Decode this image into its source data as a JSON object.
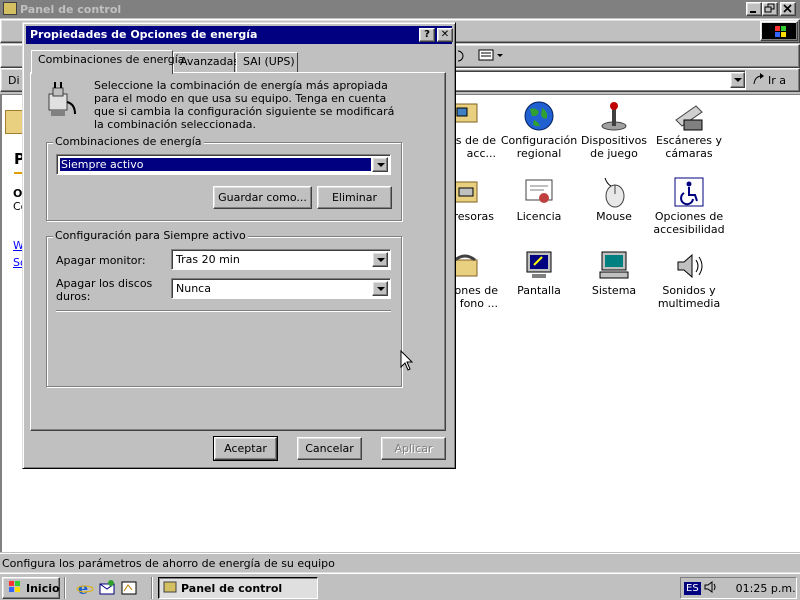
{
  "background_window": {
    "title": "Panel de control",
    "title_icon": "control-panel-icon",
    "controls": [
      "minimize-icon",
      "restore-icon",
      "close-icon"
    ],
    "go_label": "Ir a",
    "left_fragments": [
      "Di",
      "P",
      "O",
      "Co",
      "W",
      "So"
    ],
    "items": [
      {
        "label": "xiones de de acc...",
        "icon": "network-dialup-icon"
      },
      {
        "label": "Configuración regional",
        "icon": "globe-icon"
      },
      {
        "label": "Dispositivos de juego",
        "icon": "joystick-icon"
      },
      {
        "label": "Escáneres y cámaras",
        "icon": "scanner-icon"
      },
      {
        "label": "resoras",
        "icon": "printer-folder-icon"
      },
      {
        "label": "Licencia",
        "icon": "certificate-icon"
      },
      {
        "label": "Mouse",
        "icon": "mouse-icon"
      },
      {
        "label": "Opciones de accesibilidad",
        "icon": "accessibility-icon"
      },
      {
        "label": "iones de fono ...",
        "icon": "telephone-icon"
      },
      {
        "label": "Pantalla",
        "icon": "display-icon"
      },
      {
        "label": "Sistema",
        "icon": "computer-icon"
      },
      {
        "label": "Sonidos y multimedia",
        "icon": "speaker-icon"
      }
    ],
    "status_text": "Configura los parámetros de ahorro de energía de su equipo"
  },
  "dialog": {
    "title": "Propiedades de Opciones de energía",
    "help_button": "?",
    "close_button": "✕",
    "tabs": [
      {
        "label": "Combinaciones de energía",
        "active": true
      },
      {
        "label": "Avanzadas",
        "active": false
      },
      {
        "label": "SAI (UPS)",
        "active": false
      }
    ],
    "intro_text": "Seleccione la combinación de energía más apropiada para el modo en que usa su equipo. Tenga en cuenta que si cambia la configuración siguiente se modificará la combinación seleccionada.",
    "schemes_group": {
      "label": "Combinaciones de energía",
      "selected": "Siempre activo",
      "save_as_label": "Guardar como...",
      "delete_label": "Eliminar"
    },
    "settings_group": {
      "label": "Configuración para Siempre activo",
      "monitor_label": "Apagar monitor:",
      "monitor_value": "Tras 20 min",
      "disks_label": "Apagar los discos duros:",
      "disks_value": "Nunca"
    },
    "ok_label": "Aceptar",
    "cancel_label": "Cancelar",
    "apply_label": "Aplicar"
  },
  "taskbar": {
    "start_label": "Inicio",
    "quick_launch": [
      "internet-explorer-icon",
      "outlook-express-icon",
      "show-desktop-icon"
    ],
    "task_label": "Panel de control",
    "language": "ES",
    "volume_icon": "speaker-tray-icon",
    "clock": "01:25 p.m."
  },
  "colors": {
    "titlebar_active": "#000080",
    "titlebar_inactive": "#808080",
    "face": "#c0c0c0",
    "selection": "#000080"
  }
}
